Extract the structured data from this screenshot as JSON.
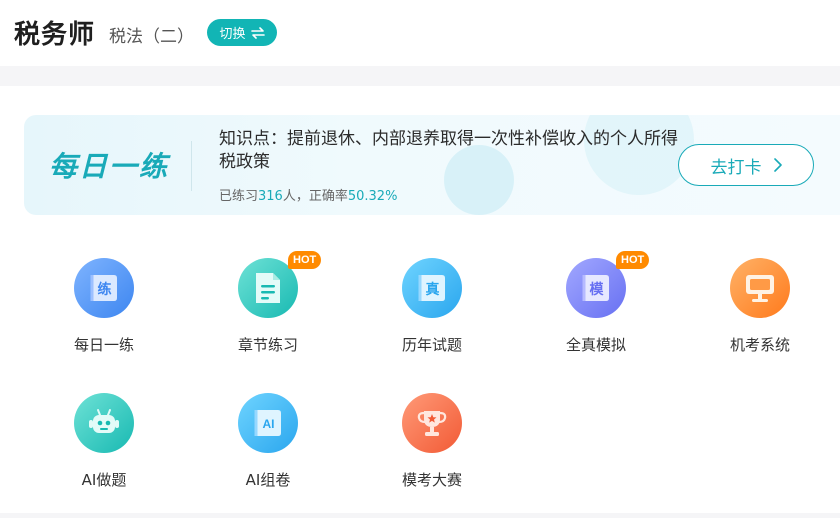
{
  "header": {
    "title": "税务师",
    "subject": "税法（二）",
    "switch_label": "切换"
  },
  "daily": {
    "logo": "每日一练",
    "topic": "知识点：提前退休、内部退养取得一次性补偿收入的个人所得税政策",
    "stats_prefix": "已练习",
    "practiced_count": "316",
    "stats_mid": "人，正确率",
    "accuracy": "50.32%",
    "checkin_label": "去打卡"
  },
  "menu": {
    "items": [
      {
        "label": "每日一练",
        "icon": "practice-book-icon",
        "glyph": "练",
        "hot": ""
      },
      {
        "label": "章节练习",
        "icon": "document-icon",
        "glyph": "",
        "hot": "HOT"
      },
      {
        "label": "历年试题",
        "icon": "exam-book-icon",
        "glyph": "真",
        "hot": ""
      },
      {
        "label": "全真模拟",
        "icon": "mock-book-icon",
        "glyph": "模",
        "hot": "HOT"
      },
      {
        "label": "机考系统",
        "icon": "computer-icon",
        "glyph": "",
        "hot": ""
      },
      {
        "label": "AI做题",
        "icon": "robot-icon",
        "glyph": "",
        "hot": ""
      },
      {
        "label": "AI组卷",
        "icon": "ai-paper-icon",
        "glyph": "AI",
        "hot": ""
      },
      {
        "label": "模考大赛",
        "icon": "trophy-icon",
        "glyph": "",
        "hot": ""
      }
    ]
  },
  "colors": {
    "accent": "#19aab8",
    "hot_badge": "#ff8a00"
  }
}
